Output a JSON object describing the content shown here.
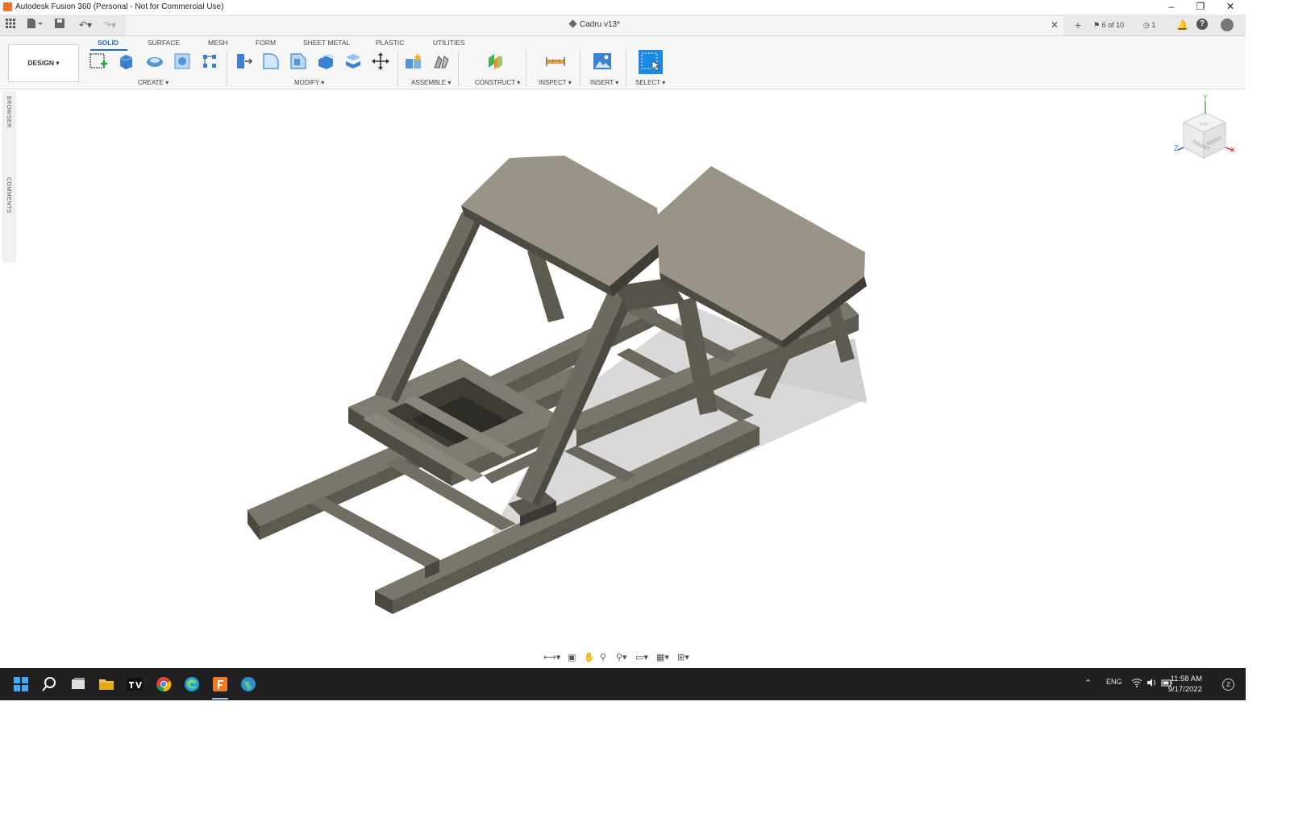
{
  "window": {
    "title": "Autodesk Fusion 360 (Personal - Not for Commercial Use)"
  },
  "document": {
    "name": "Cadru v13*",
    "version_count": "6 of 10",
    "jobs": "1"
  },
  "workspace": {
    "label": "DESIGN"
  },
  "tabs": [
    {
      "label": "SOLID",
      "active": true
    },
    {
      "label": "SURFACE"
    },
    {
      "label": "MESH"
    },
    {
      "label": "FORM"
    },
    {
      "label": "SHEET METAL"
    },
    {
      "label": "PLASTIC"
    },
    {
      "label": "UTILITIES"
    }
  ],
  "groups": {
    "create": "CREATE",
    "modify": "MODIFY",
    "assemble": "ASSEMBLE",
    "construct": "CONSTRUCT",
    "inspect": "INSPECT",
    "insert": "INSERT",
    "select": "SELECT"
  },
  "side_panels": {
    "browser": "BROWSER",
    "comments": "COMMENTS"
  },
  "viewcube": {
    "front": "FRONT",
    "right": "RIGHT",
    "top": "TOP",
    "axis_x": "X",
    "axis_y": "Y",
    "axis_z": "Z"
  },
  "tray": {
    "language": "ENG",
    "time": "11:58 AM",
    "date": "9/17/2022",
    "badge": "2"
  },
  "colors": {
    "accent": "#1e6fc2",
    "model": "#666257",
    "model_top": "#9a9488",
    "taskbar": "#202020"
  }
}
